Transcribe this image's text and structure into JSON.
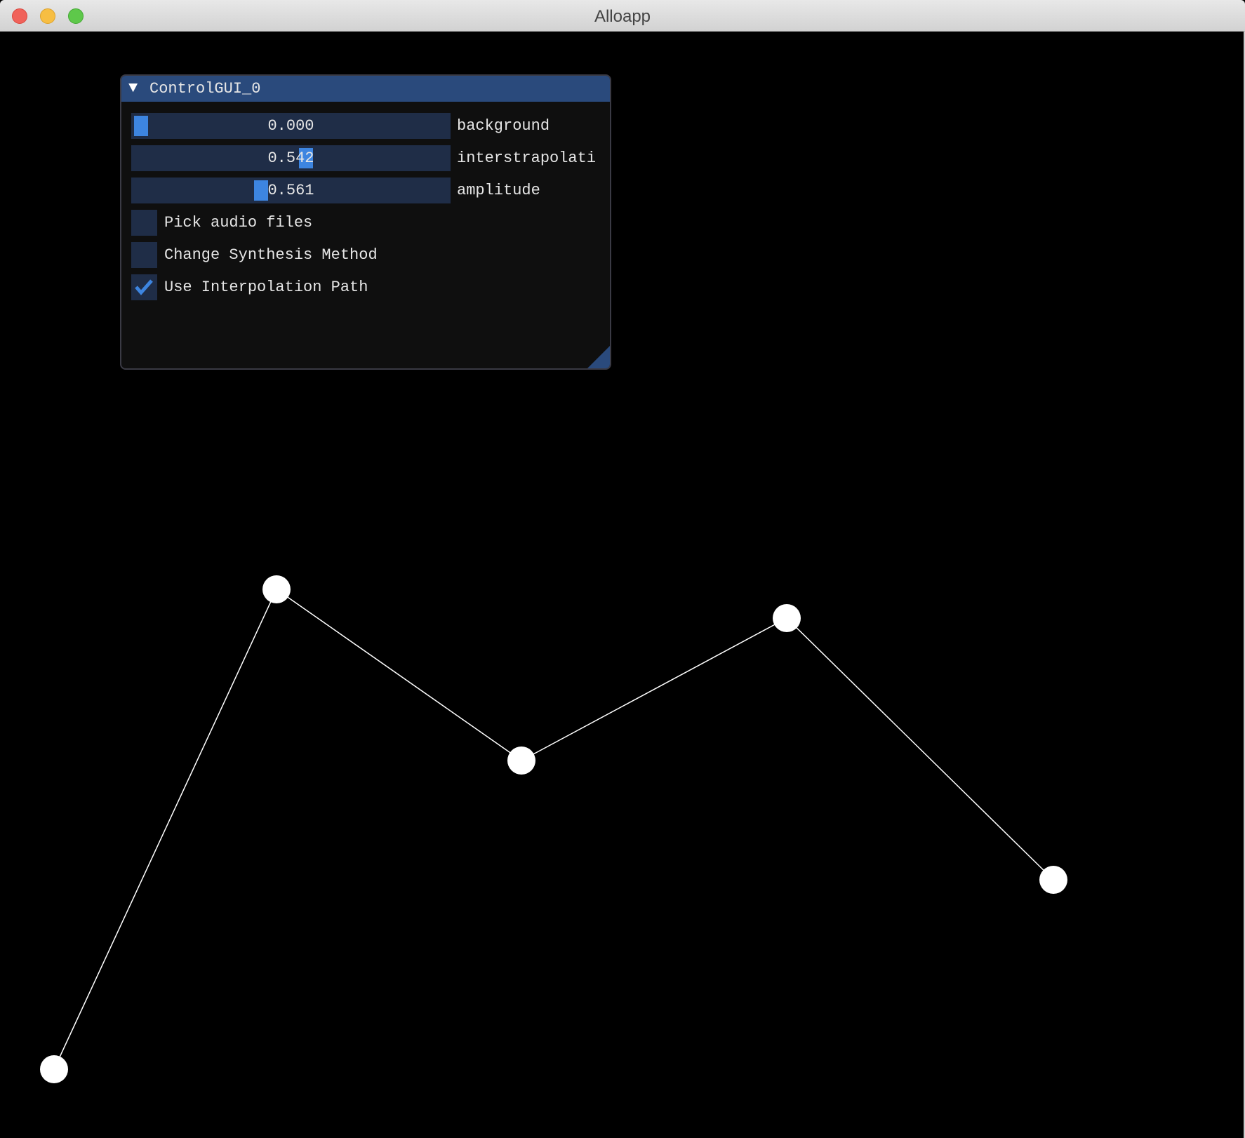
{
  "window": {
    "title": "Alloapp"
  },
  "gui": {
    "title": "ControlGUI_0",
    "sliders": [
      {
        "label": "background",
        "value": "0.000",
        "fill_fraction": 0.0
      },
      {
        "label": "interstrapolati",
        "value": "0.542",
        "fill_fraction": 0.55
      },
      {
        "label": "amplitude",
        "value": "0.561",
        "fill_fraction": 0.4
      }
    ],
    "checkboxes": [
      {
        "label": "Pick audio files",
        "checked": false
      },
      {
        "label": "Change Synthesis Method",
        "checked": false
      },
      {
        "label": "Use Interpolation Path",
        "checked": true
      }
    ]
  },
  "colors": {
    "accent": "#3d85e0",
    "header": "#2a4a7c",
    "frame": "#1f2d47"
  },
  "path": {
    "point_count": 5
  }
}
